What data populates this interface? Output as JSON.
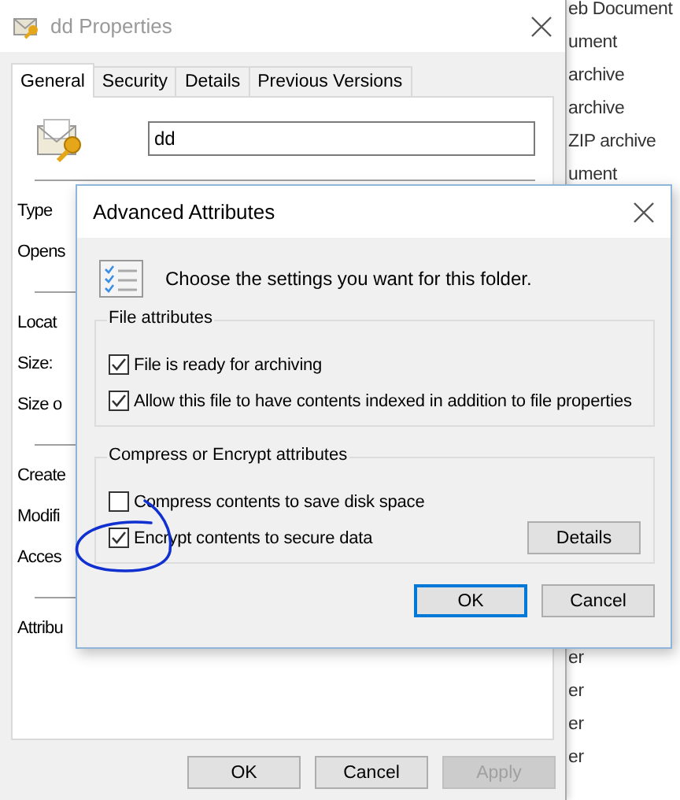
{
  "explorer": {
    "top_items": [
      "eb Document",
      "ument",
      "archive",
      "archive",
      "ZIP archive",
      "ument"
    ],
    "bottom_items": [
      "er",
      "er",
      "er",
      "er"
    ]
  },
  "properties": {
    "title": "dd Properties",
    "tabs": [
      {
        "label": "General",
        "selected": true
      },
      {
        "label": "Security",
        "selected": false
      },
      {
        "label": "Details",
        "selected": false
      },
      {
        "label": "Previous Versions",
        "selected": false
      }
    ],
    "name_value": "dd",
    "label_groups": [
      [
        "Type",
        "Opens"
      ],
      [
        "Locat",
        "Size:",
        "Size o"
      ],
      [
        "Create",
        "Modifi",
        "Acces"
      ],
      [
        "Attribu"
      ]
    ],
    "buttons": [
      {
        "label": "OK",
        "disabled": false
      },
      {
        "label": "Cancel",
        "disabled": false
      },
      {
        "label": "Apply",
        "disabled": true
      }
    ]
  },
  "dialog": {
    "title": "Advanced Attributes",
    "description": "Choose the settings you want for this folder.",
    "groups": [
      {
        "title": "File attributes",
        "options": [
          {
            "label": "File is ready for archiving",
            "checked": true
          },
          {
            "label": "Allow this file to have contents indexed in addition to file properties",
            "checked": true
          }
        ]
      },
      {
        "title": "Compress or Encrypt attributes",
        "options": [
          {
            "label": "Compress contents to save disk space",
            "checked": false
          },
          {
            "label": "Encrypt contents to secure data",
            "checked": true
          }
        ],
        "button": "Details"
      }
    ],
    "buttons": [
      {
        "label": "OK",
        "default": true
      },
      {
        "label": "Cancel",
        "default": false
      }
    ]
  }
}
